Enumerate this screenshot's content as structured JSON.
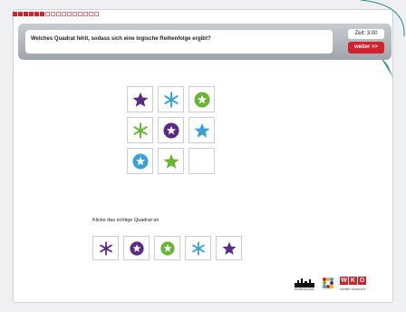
{
  "progress": {
    "done": 6,
    "total": 16
  },
  "question": {
    "text": "Welches Quadrat fehlt, sodass sich eine logische Reihenfolge ergibt?"
  },
  "timer": {
    "label": "Zeit: 3:00"
  },
  "next_button": {
    "label": "weiter >>"
  },
  "grid": [
    {
      "icon": "star-icon",
      "color": "#5b2a86"
    },
    {
      "icon": "snowflake-icon",
      "color": "#3aa0d8"
    },
    {
      "icon": "circle-star-icon",
      "color": "#6bb536"
    },
    {
      "icon": "snowflake-icon",
      "color": "#6bb536"
    },
    {
      "icon": "circle-star-icon",
      "color": "#5b2a86"
    },
    {
      "icon": "star-icon",
      "color": "#3aa0d8"
    },
    {
      "icon": "circle-star-icon",
      "color": "#3aa0d8"
    },
    {
      "icon": "star-icon",
      "color": "#6bb536"
    },
    {
      "icon": "empty",
      "color": ""
    }
  ],
  "instruction": "Klicke das richtige Quadrat an",
  "answers": [
    {
      "icon": "snowflake-icon",
      "color": "#5b2a86"
    },
    {
      "icon": "circle-star-icon",
      "color": "#5b2a86"
    },
    {
      "icon": "circle-star-icon",
      "color": "#6bb536"
    },
    {
      "icon": "snowflake-icon",
      "color": "#3aa0d8"
    },
    {
      "icon": "star-icon",
      "color": "#5b2a86"
    }
  ],
  "logos": {
    "city_caption": "stadtenkulisse",
    "wko_letters": [
      "W",
      "K",
      "O"
    ],
    "wko_tagline": "Weiter kommen."
  },
  "colors": {
    "brand_red": "#d3202a"
  }
}
